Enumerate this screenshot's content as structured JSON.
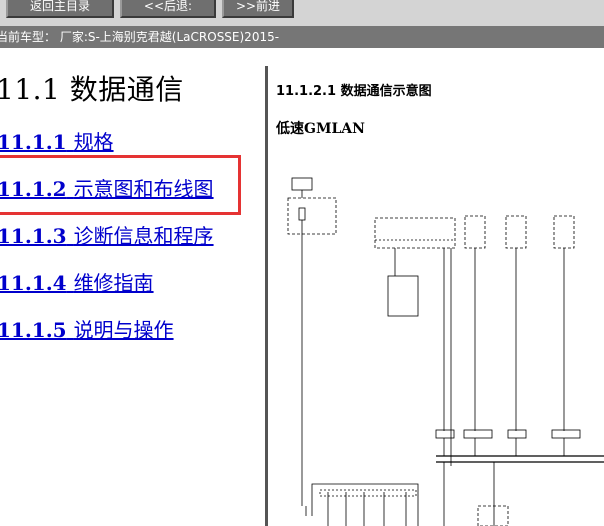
{
  "toolbar": {
    "back_to_contents": "返回主目录",
    "back": "<<后退:",
    "forward": ">>前进"
  },
  "vehicle_bar": {
    "text": "当前车型：  厂家:S-上海别克君越(LaCROSSE)2015-"
  },
  "left_pane": {
    "title": "11.1 数据通信",
    "links": [
      {
        "num": "11.1.1",
        "label": "规格"
      },
      {
        "num": "11.1.2",
        "label": "示意图和布线图"
      },
      {
        "num": "11.1.3",
        "label": "诊断信息和程序"
      },
      {
        "num": "11.1.4",
        "label": "维修指南"
      },
      {
        "num": "11.1.5",
        "label": "说明与操作"
      }
    ],
    "highlight_color": "#e53333",
    "link_color": "#0000cc"
  },
  "right_pane": {
    "section_heading": "11.1.2.1 数据通信示意图",
    "diagram_title": "低速GMLAN"
  }
}
